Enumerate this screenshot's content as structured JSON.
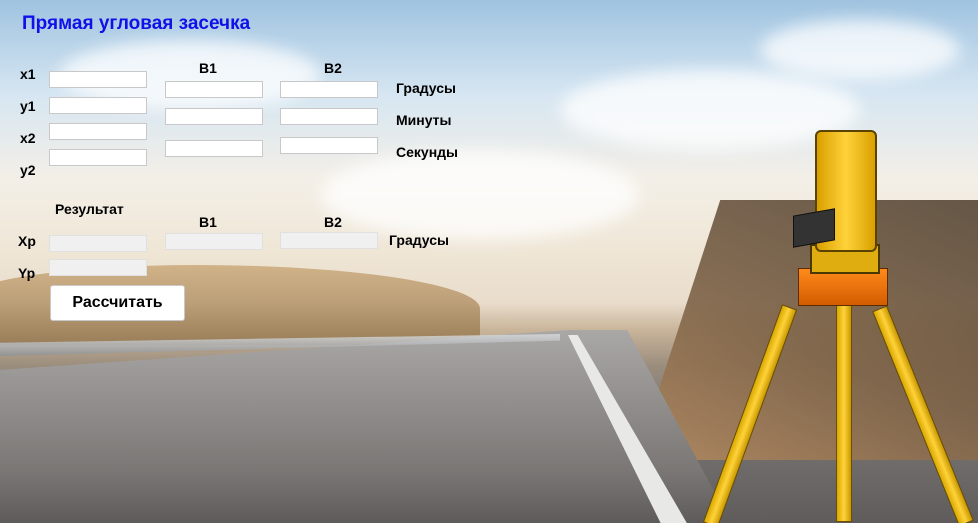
{
  "window": {
    "title": "Прямая угловая засечка"
  },
  "inputs": {
    "labels": {
      "x1": "x1",
      "y1": "y1",
      "x2": "x2",
      "y2": "y2"
    },
    "column_headers": {
      "b1": "B1",
      "b2": "B2"
    },
    "row_labels": {
      "degrees": "Градусы",
      "minutes": "Минуты",
      "seconds": "Секунды"
    },
    "values": {
      "x1": "",
      "y1": "",
      "x2": "",
      "y2": "",
      "b1_degrees": "",
      "b1_minutes": "",
      "b1_seconds": "",
      "b2_degrees": "",
      "b2_minutes": "",
      "b2_seconds": ""
    }
  },
  "results": {
    "header": "Результат",
    "labels": {
      "xp": "Xp",
      "yp": "Yp"
    },
    "column_headers": {
      "b1": "B1",
      "b2": "B2"
    },
    "row_label": "Градусы",
    "values": {
      "xp": "",
      "yp": "",
      "b1_degrees": "",
      "b2_degrees": ""
    }
  },
  "actions": {
    "calculate_label": "Рассчитать"
  },
  "colors": {
    "title": "#1010e8",
    "textbox_bg": "#ffffff",
    "readonly_bg": "#f0f0f0"
  },
  "background": {
    "image": "road-with-theodolite-on-tripod"
  }
}
